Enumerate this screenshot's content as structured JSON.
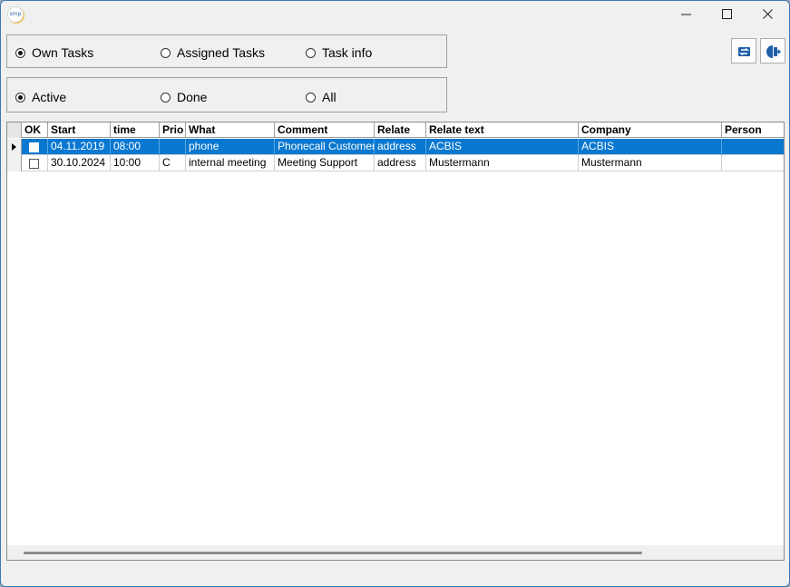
{
  "app": {
    "icon_text": "smp"
  },
  "filters": {
    "scope": [
      {
        "label": "Own Tasks",
        "selected": true
      },
      {
        "label": "Assigned Tasks",
        "selected": false
      },
      {
        "label": "Task info",
        "selected": false
      }
    ],
    "status": [
      {
        "label": "Active",
        "selected": true
      },
      {
        "label": "Done",
        "selected": false
      },
      {
        "label": "All",
        "selected": false
      }
    ]
  },
  "toolbar": {
    "refresh_icon": "refresh-icon",
    "exit_icon": "exit-icon"
  },
  "grid": {
    "columns": [
      "OK",
      "Start",
      "time",
      "Prio",
      "What",
      "Comment",
      "Relate",
      "Relate text",
      "Company",
      "Person"
    ],
    "rows": [
      {
        "selected": true,
        "ok": false,
        "cells": [
          "04.11.2019",
          "08:00",
          "",
          "phone",
          "Phonecall Customer",
          "address",
          "ACBIS",
          "ACBIS",
          ""
        ]
      },
      {
        "selected": false,
        "ok": false,
        "cells": [
          "30.10.2024",
          "10:00",
          "C",
          "internal meeting",
          "Meeting Support",
          "address",
          "Mustermann",
          "Mustermann",
          ""
        ]
      }
    ]
  },
  "colors": {
    "selection": "#0a78d0",
    "window_bg": "#f0f0f0"
  }
}
